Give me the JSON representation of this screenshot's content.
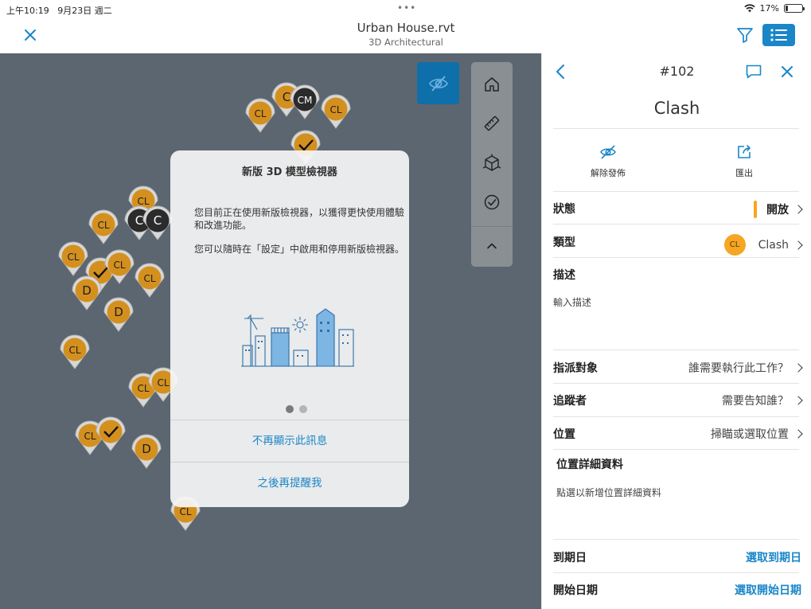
{
  "status_bar": {
    "time": "上午10:19",
    "date": "9月23日 週二",
    "battery": "17%"
  },
  "header": {
    "title": "Urban House.rvt",
    "subtitle": "3D Architectural"
  },
  "colors": {
    "accent": "#1a86c8",
    "viewer_bg": "#5b6670",
    "marker_orange": "#d4901e",
    "status_open": "#f6a623"
  },
  "viewer": {
    "markers": [
      {
        "label": "C",
        "kind": "orange"
      },
      {
        "label": "CM",
        "kind": "dark"
      },
      {
        "label": "CL",
        "kind": "orange"
      },
      {
        "label": "CL",
        "kind": "orange"
      },
      {
        "label": "",
        "kind": "check"
      },
      {
        "label": "CL",
        "kind": "orange"
      },
      {
        "label": "C",
        "kind": "dark"
      },
      {
        "label": "C",
        "kind": "dark"
      },
      {
        "label": "CL",
        "kind": "orange"
      },
      {
        "label": "CL",
        "kind": "orange"
      },
      {
        "label": "",
        "kind": "check"
      },
      {
        "label": "CL",
        "kind": "orange"
      },
      {
        "label": "CL",
        "kind": "orange"
      },
      {
        "label": "D",
        "kind": "orange"
      },
      {
        "label": "D",
        "kind": "orange"
      },
      {
        "label": "CL",
        "kind": "orange"
      },
      {
        "label": "CL",
        "kind": "orange"
      },
      {
        "label": "CL",
        "kind": "orange"
      },
      {
        "label": "CL",
        "kind": "orange"
      },
      {
        "label": "",
        "kind": "check"
      },
      {
        "label": "D",
        "kind": "orange"
      },
      {
        "label": "CL",
        "kind": "orange"
      }
    ],
    "toolbar": [
      "home-icon",
      "measure-icon",
      "section-box-icon",
      "issue-check-icon",
      "collapse-icon"
    ]
  },
  "modal": {
    "title": "新版 3D 模型檢視器",
    "body1": "您目前正在使用新版檢視器，以獲得更快使用體驗和改進功能。",
    "body2": "您可以隨時在「設定」中啟用和停用新版檢視器。",
    "dont_show": "不再顯示此訊息",
    "remind_later": "之後再提醒我"
  },
  "panel": {
    "number": "#102",
    "title": "Clash",
    "actions": {
      "unpublish": "解除發佈",
      "export": "匯出"
    },
    "status": {
      "label": "狀態",
      "value": "開放"
    },
    "type": {
      "label": "類型",
      "badge": "CL",
      "value": "Clash"
    },
    "description": {
      "label": "描述",
      "placeholder": "輸入描述"
    },
    "assigned": {
      "label": "指派對象",
      "value": "誰需要執行此工作？"
    },
    "watchers": {
      "label": "追蹤者",
      "value": "需要告知誰？"
    },
    "location": {
      "label": "位置",
      "value": "掃瞄或選取位置"
    },
    "location_details": {
      "label": "位置詳細資料",
      "placeholder": "點選以新增位置詳細資料"
    },
    "due_date": {
      "label": "到期日",
      "value": "選取到期日"
    },
    "start_date": {
      "label": "開始日期",
      "value": "選取開始日期"
    }
  }
}
